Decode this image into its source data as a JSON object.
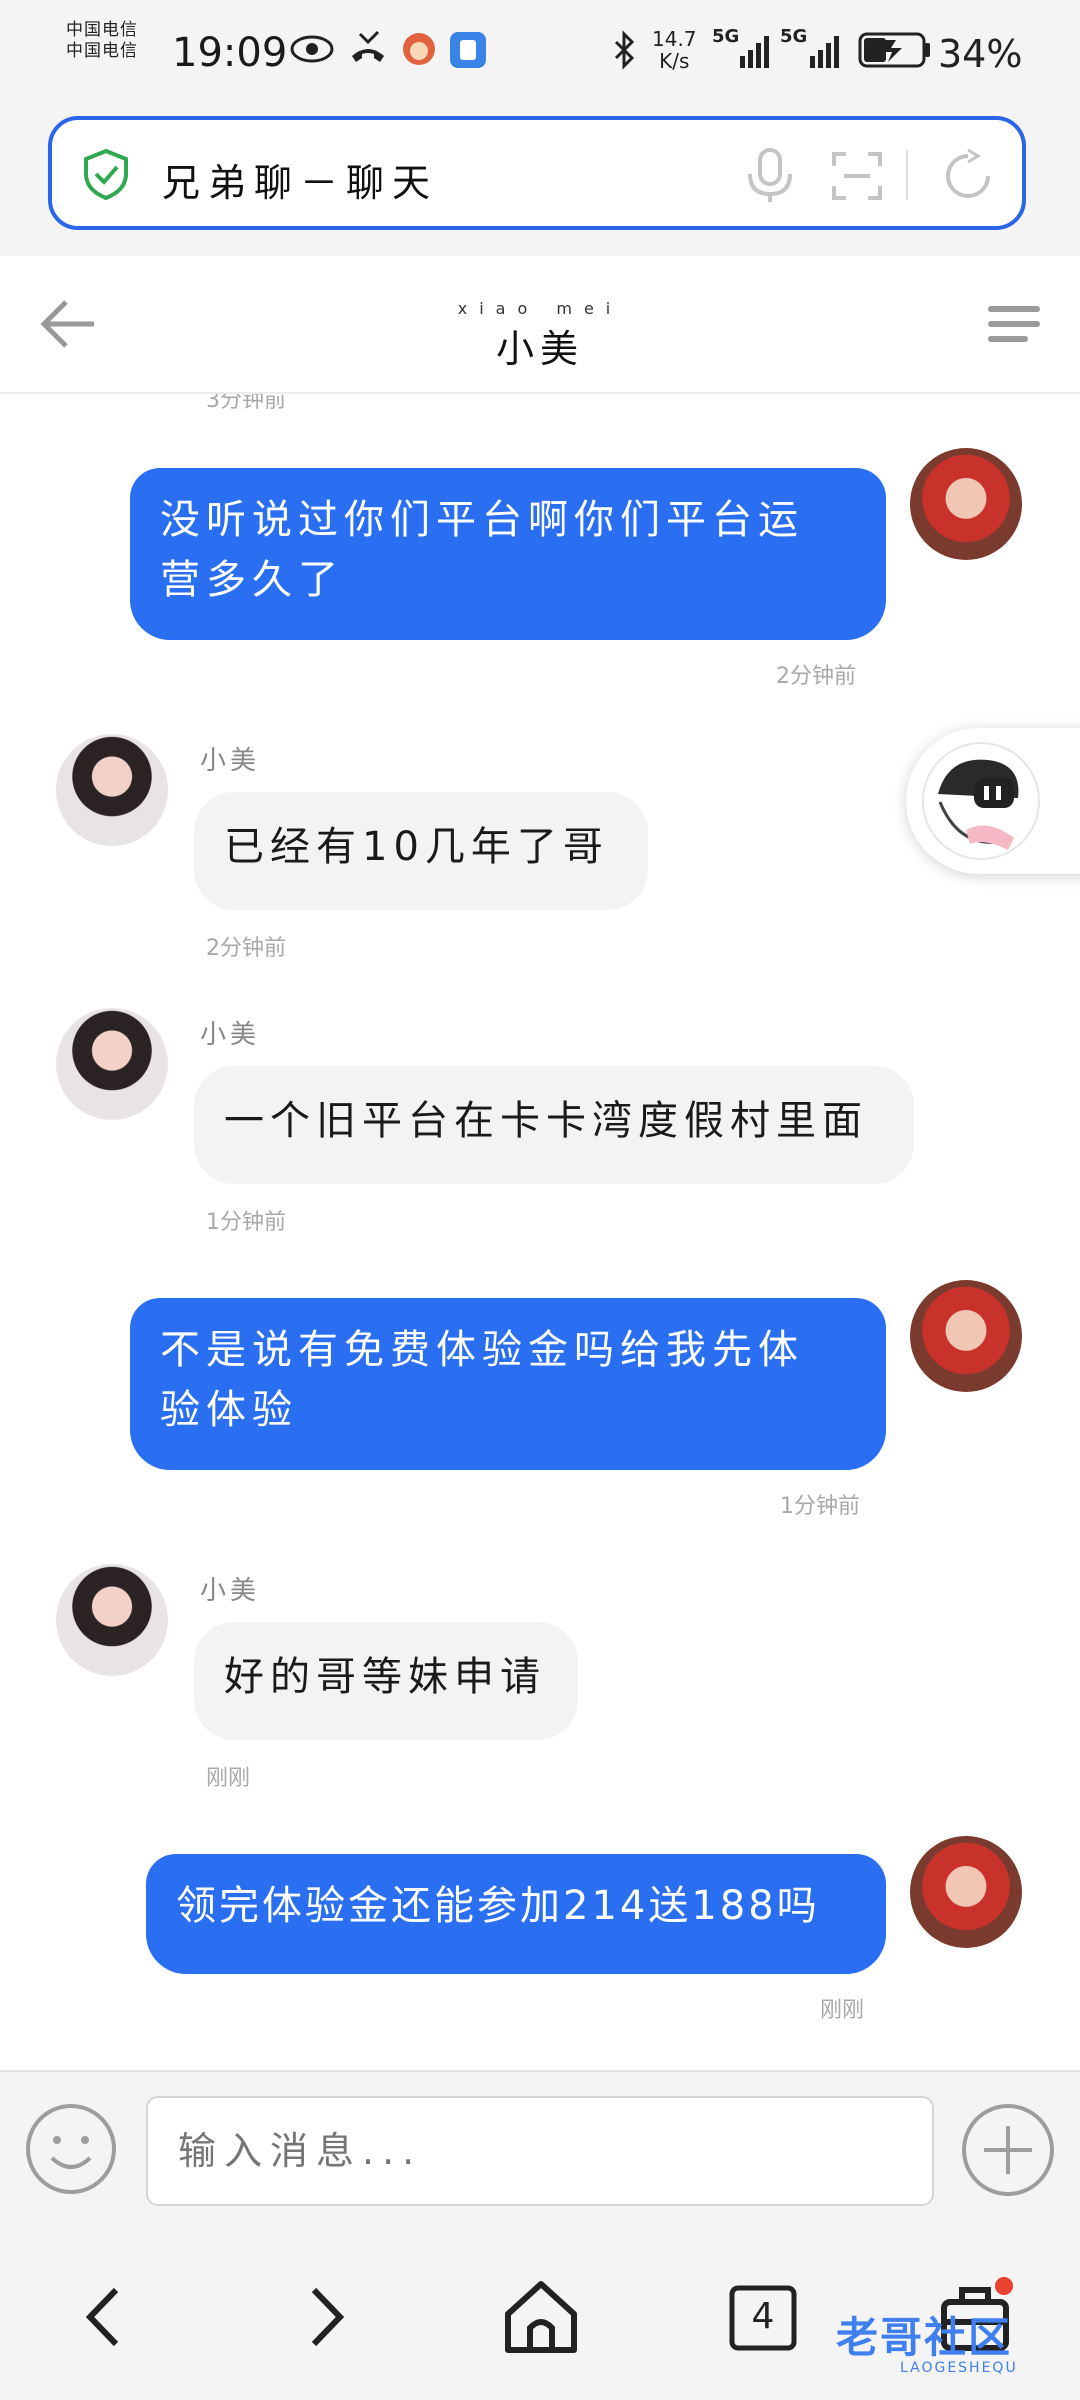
{
  "status_bar": {
    "carrier_1": "中国电信",
    "carrier_2": "中国电信",
    "time": "19:09",
    "net_speed_value": "14.7",
    "net_speed_unit": "K/s",
    "signal_1": "5G",
    "signal_2": "5G",
    "battery": "34%",
    "icons": [
      "eye-icon",
      "missed-call-icon",
      "app-avatar-icon",
      "notes-app-icon",
      "bluetooth-icon",
      "signal-icon",
      "battery-charging-icon"
    ]
  },
  "address_bar": {
    "page_title": "兄弟聊－聊天",
    "icons": [
      "shield-check-icon",
      "microphone-icon",
      "scan-icon",
      "refresh-icon"
    ]
  },
  "chat_header": {
    "title": "小美",
    "title_pinyin": "xiao mei"
  },
  "messages": [
    {
      "direction": "in",
      "timestamp": "3分钟前"
    },
    {
      "direction": "out",
      "text": "没听说过你们平台啊你们平台运营多久了",
      "line1": "没听说过你们平台啊你们平台运",
      "line2": "营多久了",
      "timestamp": "2分钟前"
    },
    {
      "direction": "in",
      "sender": "小美",
      "text": "已经有10几年了哥",
      "timestamp": "2分钟前"
    },
    {
      "direction": "in",
      "sender": "小美",
      "text": "一个旧平台在卡卡湾度假村里面",
      "timestamp": "1分钟前"
    },
    {
      "direction": "out",
      "text": "不是说有免费体验金吗给我先体验体验",
      "line1": "不是说有免费体验金吗给我先体",
      "line2": "验体验",
      "timestamp": "1分钟前"
    },
    {
      "direction": "in",
      "sender": "小美",
      "text": "好的哥等妹申请",
      "timestamp": "刚刚"
    },
    {
      "direction": "out",
      "text": "领完体验金还能参加214送188吗",
      "timestamp": "刚刚"
    }
  ],
  "input_bar": {
    "placeholder": "输入消息...",
    "icons": [
      "emoji-icon",
      "plus-icon"
    ]
  },
  "nav_bar": {
    "tab_count": "4",
    "watermark": "老哥社区",
    "watermark_sub": "LAOGESHEQU",
    "icons": [
      "back-arrow-icon",
      "forward-arrow-icon",
      "home-icon",
      "tabs-icon",
      "toolbox-icon"
    ]
  },
  "colors": {
    "accent": "#2a6ff2",
    "bubble_in": "#f3f3f3",
    "address_border": "#2b66e8",
    "shield": "#2fa84f"
  }
}
